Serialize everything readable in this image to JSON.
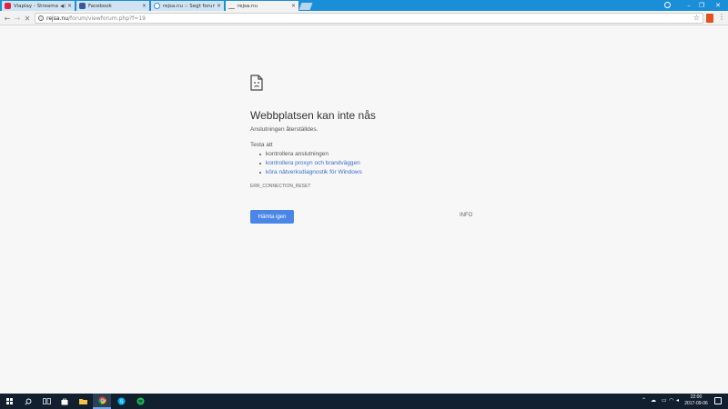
{
  "tabs": [
    {
      "title": "Viaplay - Streama filmer",
      "favicon_color": "#e2214b",
      "audio": true
    },
    {
      "title": "Facebook",
      "favicon_color": "#3b5998"
    },
    {
      "title": "rejsa.nu :: Segt forum ci",
      "favicon_color": "#4a86e8"
    },
    {
      "title": "rejsa.nu",
      "favicon_color": "#888888",
      "active": true
    }
  ],
  "toolbar": {
    "url_host": "rejsa.nu",
    "url_path": "/forum/viewforum.php?f=19"
  },
  "error": {
    "title": "Webbplatsen kan inte nås",
    "subtitle": "Anslutningen återställdes.",
    "try_label": "Testa att",
    "suggestions": [
      {
        "text": "kontrollera anslutningen",
        "link": false
      },
      {
        "text": "kontrollera proxyn och brandväggen",
        "link": true
      },
      {
        "text": "köra nätverksdiagnostik för Windows",
        "link": true
      }
    ],
    "code": "ERR_CONNECTION_RESET",
    "reload_label": "Hämta igen",
    "details_label": "INFO"
  },
  "taskbar": {
    "time": "22:00",
    "date": "2017-09-06"
  },
  "colors": {
    "tabstrip": "#1a8fd8",
    "primary_button": "#4a86e8",
    "link": "#3b6ec9",
    "taskbar": "#111f2e"
  }
}
